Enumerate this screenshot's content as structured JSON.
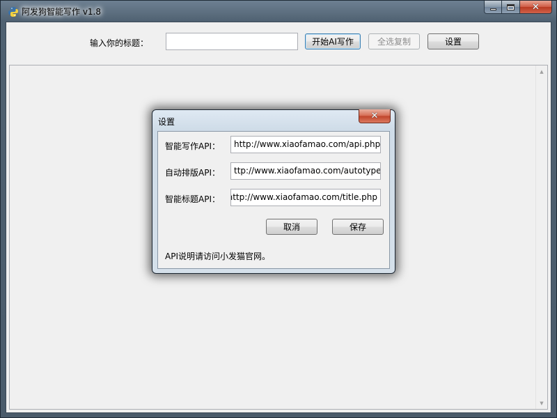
{
  "window": {
    "title": "阿发狗智能写作 v1.8",
    "min_glyph": "—",
    "max_glyph": "□",
    "close_glyph": "✕"
  },
  "toolbar": {
    "title_label": "输入你的标题：",
    "title_input_value": "",
    "start_button": "开始AI写作",
    "copy_all_button": "全选复制",
    "settings_button": "设置"
  },
  "content": {
    "text": ""
  },
  "settings_dialog": {
    "title": "设置",
    "close_glyph": "✕",
    "fields": [
      {
        "label": "智能写作API：",
        "value": "http://www.xiaofamao.com/api.php"
      },
      {
        "label": "自动排版API：",
        "value": "ttp://www.xiaofamao.com/autotype."
      },
      {
        "label": "智能标题API：",
        "value": "http://www.xiaofamao.com/title.php"
      }
    ],
    "cancel_button": "取消",
    "save_button": "保存",
    "note": "API说明请访问小发猫官网。"
  },
  "icons": {
    "app": "python-app-icon",
    "scroll_up": "scroll-up-arrow-icon",
    "scroll_down": "scroll-down-arrow-icon"
  },
  "colors": {
    "frame": "#4f6171",
    "client_bg": "#f0f0f0",
    "close_red": "#c0432a",
    "dialog_frame": "#cfdce8"
  }
}
